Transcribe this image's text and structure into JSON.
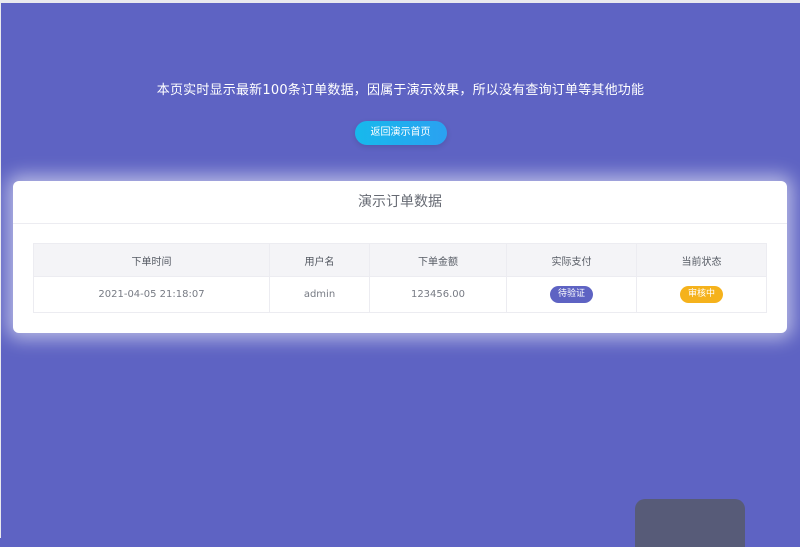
{
  "header": {
    "notice": "本页实时显示最新100条订单数据，因属于演示效果，所以没有查询订单等其他功能",
    "back_button_label": "返回演示首页"
  },
  "card": {
    "title": "演示订单数据"
  },
  "table": {
    "columns": [
      "下单时间",
      "用户名",
      "下单金额",
      "实际支付",
      "当前状态"
    ],
    "rows": [
      {
        "order_time": "2021-04-05 21:18:07",
        "username": "admin",
        "amount": "123456.00",
        "payment": "待验证",
        "status": "审核中"
      }
    ]
  },
  "colors": {
    "background": "#5e63c3",
    "button": "#17b9ec",
    "payment_badge": "#5e63c3",
    "status_badge": "#f5b21c"
  }
}
